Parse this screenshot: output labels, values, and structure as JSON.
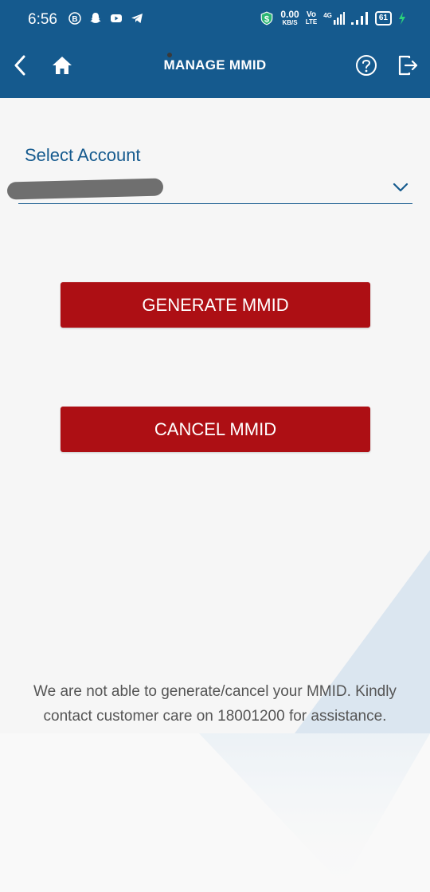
{
  "status_bar": {
    "time": "6:56",
    "speed_value": "0.00",
    "speed_unit": "KB/S",
    "volte_top": "Vo",
    "volte_bottom": "LTE",
    "network": "4G",
    "battery": "61",
    "icons": [
      "b-badge-icon",
      "snapchat-icon",
      "youtube-icon",
      "telegram-icon",
      "data-saver-icon",
      "signal-icon",
      "signal-icon",
      "charging-icon"
    ]
  },
  "header": {
    "title": "MANAGE MMID",
    "icons": [
      "back-arrow-icon",
      "home-icon",
      "help-icon",
      "logout-icon"
    ]
  },
  "account": {
    "label": "Select Account",
    "selected_value": "(redacted)"
  },
  "actions": {
    "generate_label": "GENERATE MMID",
    "cancel_label": "CANCEL MMID"
  },
  "message": "We are not able to generate/cancel your MMID. Kindly contact customer care on 18001200 for assistance.",
  "colors": {
    "primary": "#155a8e",
    "button": "#ad0f14",
    "background": "#f6f6f6"
  }
}
